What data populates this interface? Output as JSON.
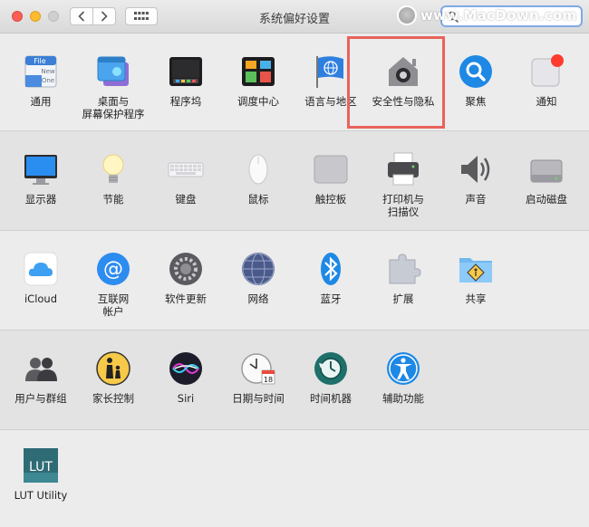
{
  "window": {
    "title": "系统偏好设置"
  },
  "search": {
    "value": "",
    "placeholder": ""
  },
  "watermark": {
    "text": "www.MacDown.com"
  },
  "colors": {
    "highlight": "#e8635b",
    "search_focus": "#7fa9e8"
  },
  "rows": [
    {
      "items": [
        {
          "label": "通用",
          "icon": "general-icon"
        },
        {
          "label": "桌面与\n屏幕保护程序",
          "icon": "desktop-screensaver-icon"
        },
        {
          "label": "程序坞",
          "icon": "dock-icon"
        },
        {
          "label": "调度中心",
          "icon": "mission-control-icon"
        },
        {
          "label": "语言与地区",
          "icon": "language-region-icon"
        },
        {
          "label": "安全性与隐私",
          "icon": "security-privacy-icon"
        },
        {
          "label": "聚焦",
          "icon": "spotlight-icon"
        },
        {
          "label": "通知",
          "icon": "notifications-icon"
        }
      ]
    },
    {
      "items": [
        {
          "label": "显示器",
          "icon": "displays-icon"
        },
        {
          "label": "节能",
          "icon": "energy-saver-icon"
        },
        {
          "label": "键盘",
          "icon": "keyboard-icon"
        },
        {
          "label": "鼠标",
          "icon": "mouse-icon"
        },
        {
          "label": "触控板",
          "icon": "trackpad-icon"
        },
        {
          "label": "打印机与\n扫描仪",
          "icon": "printer-scanner-icon"
        },
        {
          "label": "声音",
          "icon": "sound-icon"
        },
        {
          "label": "启动磁盘",
          "icon": "startup-disk-icon"
        }
      ]
    },
    {
      "items": [
        {
          "label": "iCloud",
          "icon": "icloud-icon"
        },
        {
          "label": "互联网\n帐户",
          "icon": "internet-accounts-icon"
        },
        {
          "label": "软件更新",
          "icon": "software-update-icon"
        },
        {
          "label": "网络",
          "icon": "network-icon"
        },
        {
          "label": "蓝牙",
          "icon": "bluetooth-icon"
        },
        {
          "label": "扩展",
          "icon": "extensions-icon"
        },
        {
          "label": "共享",
          "icon": "sharing-icon"
        }
      ]
    },
    {
      "items": [
        {
          "label": "用户与群组",
          "icon": "users-groups-icon"
        },
        {
          "label": "家长控制",
          "icon": "parental-controls-icon"
        },
        {
          "label": "Siri",
          "icon": "siri-icon"
        },
        {
          "label": "日期与时间",
          "icon": "date-time-icon"
        },
        {
          "label": "时间机器",
          "icon": "time-machine-icon"
        },
        {
          "label": "辅助功能",
          "icon": "accessibility-icon"
        }
      ]
    },
    {
      "items": [
        {
          "label": "LUT Utility",
          "icon": "lut-utility-icon"
        }
      ]
    }
  ],
  "icon_text": {
    "file": "File",
    "new": "New",
    "one": "One",
    "lut": "LUT",
    "calendar_day": "18"
  }
}
